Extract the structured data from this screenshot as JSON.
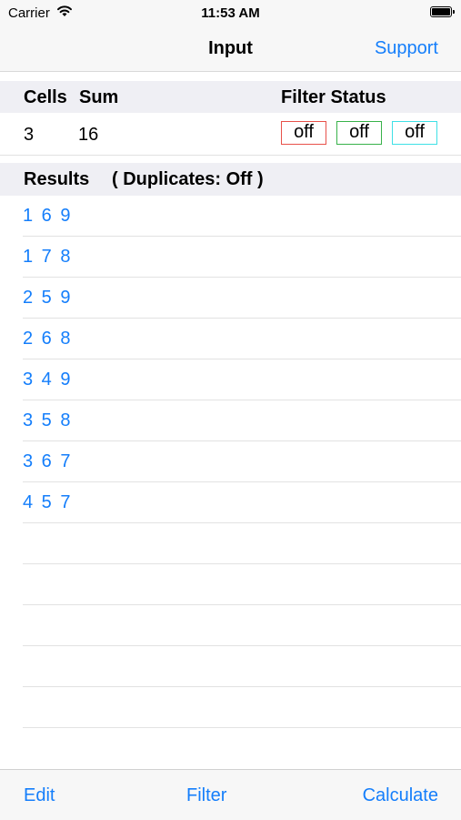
{
  "status_bar": {
    "carrier": "Carrier",
    "time": "11:53 AM"
  },
  "nav": {
    "title": "Input",
    "support": "Support"
  },
  "input_header": {
    "cells": "Cells",
    "sum": "Sum",
    "filter_status": "Filter Status"
  },
  "input_row": {
    "cells": "3",
    "sum": "16",
    "filters": [
      {
        "label": "off",
        "color": "#e8514a"
      },
      {
        "label": "off",
        "color": "#38b24a"
      },
      {
        "label": "off",
        "color": "#3ee0e6"
      }
    ]
  },
  "results_header": {
    "title": "Results",
    "duplicates": "( Duplicates:  Off )"
  },
  "results": [
    "1 6 9",
    "1 7 8",
    "2 5 9",
    "2 6 8",
    "3 4 9",
    "3 5 8",
    "3 6 7",
    "4 5 7",
    "",
    "",
    "",
    "",
    "",
    ""
  ],
  "toolbar": {
    "edit": "Edit",
    "filter": "Filter",
    "calculate": "Calculate"
  },
  "colors": {
    "accent": "#147efb",
    "header_bg": "#efeff4",
    "bar_bg": "#f7f7f7"
  }
}
